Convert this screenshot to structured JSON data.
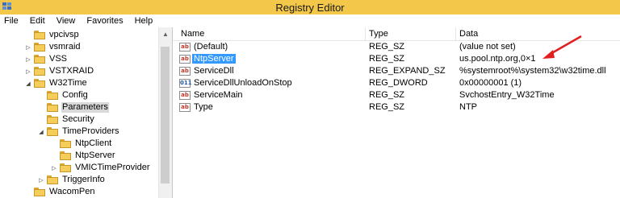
{
  "window": {
    "title": "Registry Editor"
  },
  "menu": [
    "File",
    "Edit",
    "View",
    "Favorites",
    "Help"
  ],
  "tree": [
    {
      "label": "vpcivsp",
      "expander": "",
      "level": 0
    },
    {
      "label": "vsmraid",
      "expander": "▷",
      "level": 0
    },
    {
      "label": "VSS",
      "expander": "▷",
      "level": 0
    },
    {
      "label": "VSTXRAID",
      "expander": "▷",
      "level": 0
    },
    {
      "label": "W32Time",
      "expander": "◢",
      "level": 0
    },
    {
      "label": "Config",
      "expander": "",
      "level": 1
    },
    {
      "label": "Parameters",
      "expander": "",
      "level": 1,
      "selected": true
    },
    {
      "label": "Security",
      "expander": "",
      "level": 1
    },
    {
      "label": "TimeProviders",
      "expander": "◢",
      "level": 1
    },
    {
      "label": "NtpClient",
      "expander": "",
      "level": 2
    },
    {
      "label": "NtpServer",
      "expander": "",
      "level": 2
    },
    {
      "label": "VMICTimeProvider",
      "expander": "▷",
      "level": 2
    },
    {
      "label": "TriggerInfo",
      "expander": "▷",
      "level": 1
    },
    {
      "label": "WacomPen",
      "expander": "",
      "level": 0
    }
  ],
  "columns": {
    "name": "Name",
    "type": "Type",
    "data": "Data"
  },
  "values": [
    {
      "name": "(Default)",
      "type": "REG_SZ",
      "data": "(value not set)",
      "icon": "sz"
    },
    {
      "name": "NtpServer",
      "type": "REG_SZ",
      "data": "us.pool.ntp.org,0×1",
      "icon": "sz",
      "selected": true
    },
    {
      "name": "ServiceDll",
      "type": "REG_EXPAND_SZ",
      "data": "%systemroot%\\system32\\w32time.dll",
      "icon": "sz"
    },
    {
      "name": "ServiceDllUnloadOnStop",
      "type": "REG_DWORD",
      "data": "0x00000001 (1)",
      "icon": "bin"
    },
    {
      "name": "ServiceMain",
      "type": "REG_SZ",
      "data": "SvchostEntry_W32Time",
      "icon": "sz"
    },
    {
      "name": "Type",
      "type": "REG_SZ",
      "data": "NTP",
      "icon": "sz"
    }
  ],
  "icons": {
    "sz": "ab",
    "bin": "011"
  },
  "colors": {
    "titlebar": "#f2c74a",
    "selection": "#3399ff",
    "arrow": "#e02020"
  }
}
